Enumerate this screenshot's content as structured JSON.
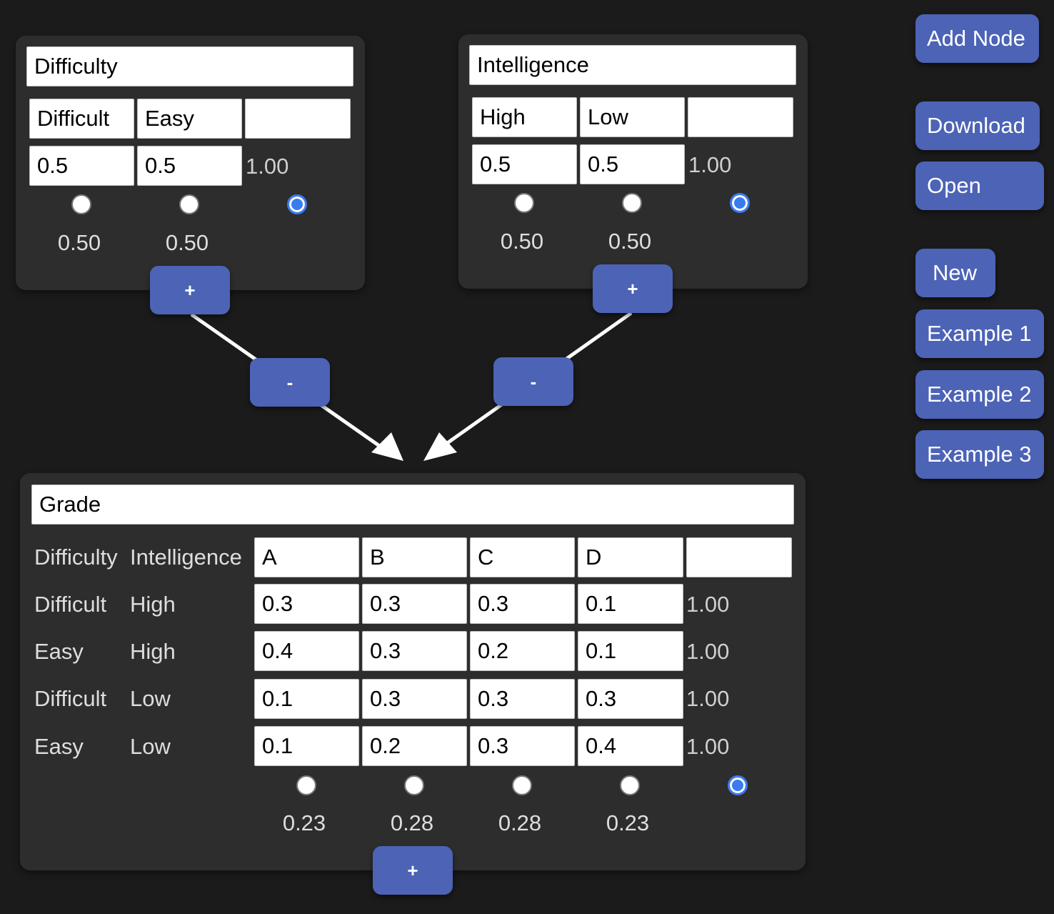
{
  "sidebar": {
    "add_node": "Add Node",
    "download": "Download",
    "open": "Open",
    "new": "New",
    "example1": "Example 1",
    "example2": "Example 2",
    "example3": "Example 3"
  },
  "nodes": {
    "difficulty": {
      "name": "Difficulty",
      "states": [
        "Difficult",
        "Easy",
        ""
      ],
      "probs": [
        "0.5",
        "0.5"
      ],
      "sum": "1.00",
      "marginals": [
        "0.50",
        "0.50"
      ],
      "selected_radio": 2,
      "add_label": "+"
    },
    "intelligence": {
      "name": "Intelligence",
      "states": [
        "High",
        "Low",
        ""
      ],
      "probs": [
        "0.5",
        "0.5"
      ],
      "sum": "1.00",
      "marginals": [
        "0.50",
        "0.50"
      ],
      "selected_radio": 2,
      "add_label": "+"
    },
    "grade": {
      "name": "Grade",
      "parent_headers": [
        "Difficulty",
        "Intelligence"
      ],
      "states": [
        "A",
        "B",
        "C",
        "D",
        ""
      ],
      "rows": [
        {
          "parents": [
            "Difficult",
            "High"
          ],
          "values": [
            "0.3",
            "0.3",
            "0.3",
            "0.1"
          ],
          "sum": "1.00"
        },
        {
          "parents": [
            "Easy",
            "High"
          ],
          "values": [
            "0.4",
            "0.3",
            "0.2",
            "0.1"
          ],
          "sum": "1.00"
        },
        {
          "parents": [
            "Difficult",
            "Low"
          ],
          "values": [
            "0.1",
            "0.3",
            "0.3",
            "0.3"
          ],
          "sum": "1.00"
        },
        {
          "parents": [
            "Easy",
            "Low"
          ],
          "values": [
            "0.1",
            "0.2",
            "0.3",
            "0.4"
          ],
          "sum": "1.00"
        }
      ],
      "marginals": [
        "0.23",
        "0.28",
        "0.28",
        "0.23"
      ],
      "selected_radio": 4,
      "add_label": "+"
    }
  },
  "edges": [
    {
      "from": "Difficulty",
      "to": "Grade",
      "remove_label": "-"
    },
    {
      "from": "Intelligence",
      "to": "Grade",
      "remove_label": "-"
    }
  ],
  "colors": {
    "background": "#1b1b1b",
    "node": "#2d2d2d",
    "button": "#4c63b6",
    "radio_checked": "#3b7bf0"
  }
}
